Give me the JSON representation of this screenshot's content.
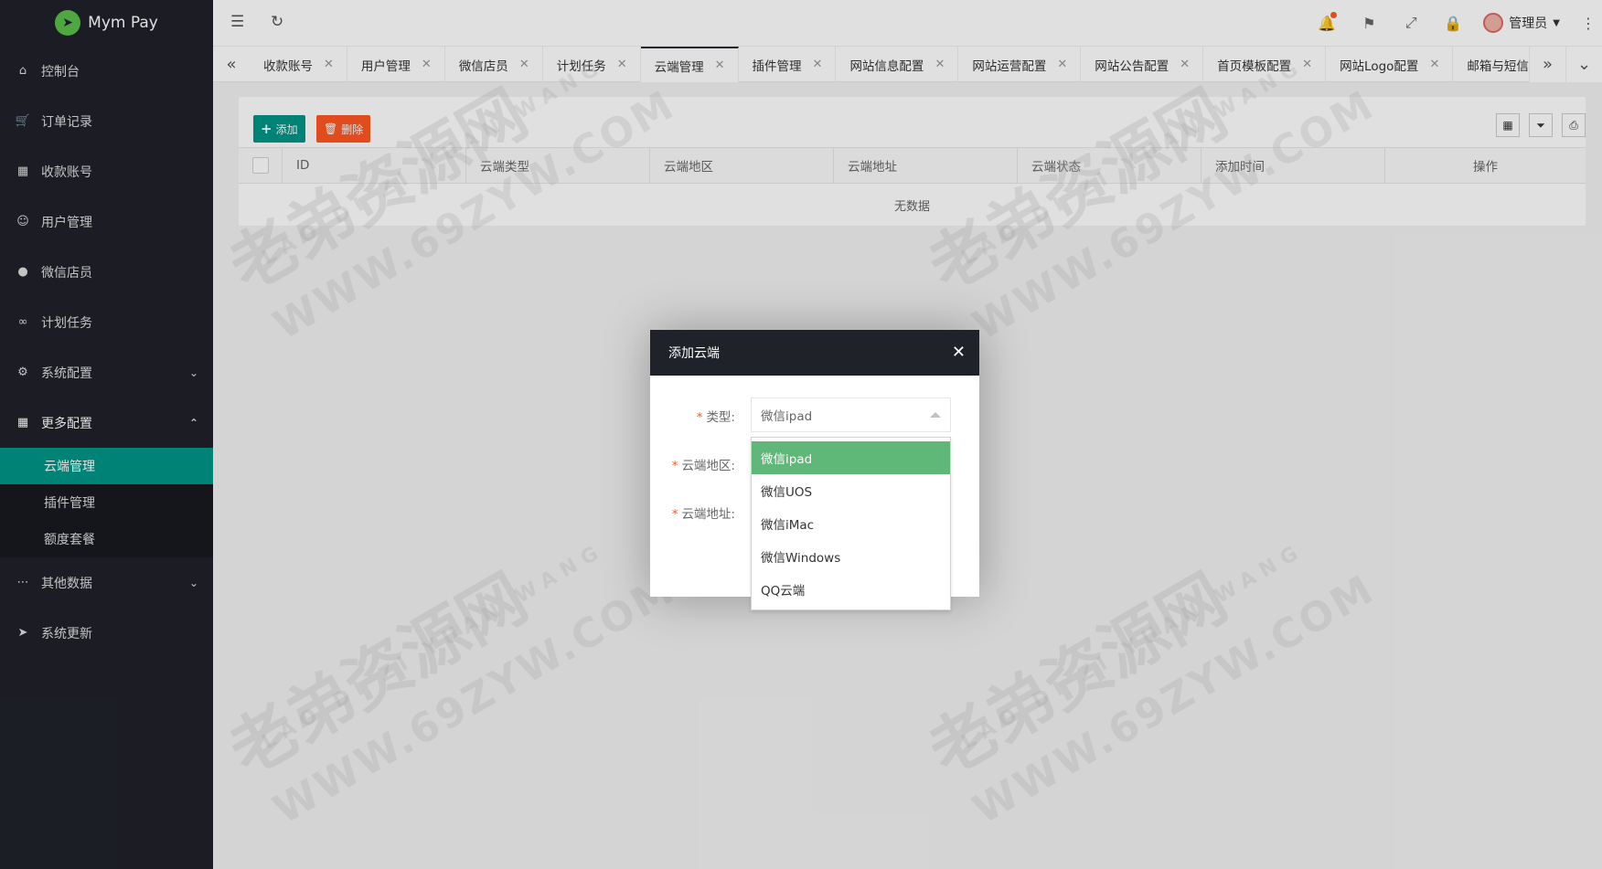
{
  "app": {
    "name": "Mym Pay"
  },
  "sidebar": {
    "items": [
      {
        "label": "控制台",
        "icon": "home-icon"
      },
      {
        "label": "订单记录",
        "icon": "cart-icon"
      },
      {
        "label": "收款账号",
        "icon": "grid-icon"
      },
      {
        "label": "用户管理",
        "icon": "user-icon"
      },
      {
        "label": "微信店员",
        "icon": "wechat-icon"
      },
      {
        "label": "计划任务",
        "icon": "binoculars-icon"
      },
      {
        "label": "系统配置",
        "icon": "gear-icon",
        "arrow": "expand"
      },
      {
        "label": "更多配置",
        "icon": "apps-icon",
        "arrow": "collapse"
      }
    ],
    "sub_items": [
      {
        "label": "云端管理",
        "active": true
      },
      {
        "label": "插件管理"
      },
      {
        "label": "额度套餐"
      }
    ],
    "bottom_items": [
      {
        "label": "其他数据",
        "icon": "ellipsis-icon",
        "arrow": "expand"
      },
      {
        "label": "系统更新",
        "icon": "send-icon"
      }
    ]
  },
  "header": {
    "user_name": "管理员"
  },
  "tabs": [
    {
      "label": "收款账号"
    },
    {
      "label": "用户管理"
    },
    {
      "label": "微信店员"
    },
    {
      "label": "计划任务"
    },
    {
      "label": "云端管理",
      "active": true
    },
    {
      "label": "插件管理"
    },
    {
      "label": "网站信息配置"
    },
    {
      "label": "网站运营配置"
    },
    {
      "label": "网站公告配置"
    },
    {
      "label": "首页模板配置"
    },
    {
      "label": "网站Logo配置"
    },
    {
      "label": "邮箱与短信配置"
    }
  ],
  "toolbar": {
    "add_label": "添加",
    "delete_label": "删除"
  },
  "table": {
    "columns": [
      "ID",
      "云端类型",
      "云端地区",
      "云端地址",
      "云端状态",
      "添加时间",
      "操作"
    ],
    "empty_text": "无数据"
  },
  "modal": {
    "title": "添加云端",
    "fields": [
      {
        "label": "类型:",
        "value": "微信ipad"
      },
      {
        "label": "云端地区:"
      },
      {
        "label": "云端地址:"
      }
    ],
    "dropdown_options": [
      "微信ipad",
      "微信UOS",
      "微信iMac",
      "微信Windows",
      "QQ云端"
    ],
    "selected_option": "微信ipad"
  },
  "watermark": {
    "text": "老弟资源网",
    "sub_text": "WWW.69ZYW.COM",
    "pinyin": "LAO DI ZI YUAN WANG"
  },
  "colors": {
    "sidebar_bg": "#20222a",
    "accent": "#009688",
    "danger": "#ff5722",
    "selected_option": "#5fb878"
  }
}
